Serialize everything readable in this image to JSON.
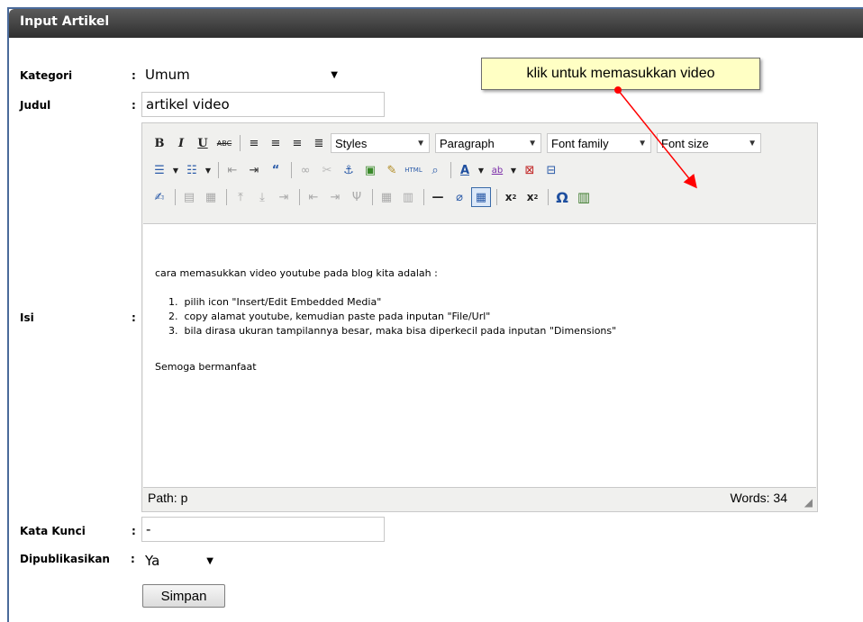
{
  "panel": {
    "title": "Input Artikel"
  },
  "form": {
    "kategori": {
      "label": "Kategori",
      "colon": ":",
      "value": "Umum"
    },
    "judul": {
      "label": "Judul",
      "colon": ":",
      "value": "artikel video"
    },
    "isi": {
      "label": "Isi",
      "colon": ":"
    },
    "kata_kunci": {
      "label": "Kata Kunci",
      "colon": ":",
      "value": "-"
    },
    "dipublikasikan": {
      "label": "Dipublikasikan",
      "colon": ":",
      "value": "Ya"
    },
    "submit_label": "Simpan"
  },
  "editor": {
    "dropdowns": {
      "styles": "Styles",
      "paragraph": "Paragraph",
      "font_family": "Font family",
      "font_size": "Font size"
    },
    "content": {
      "intro": "cara memasukkan video youtube pada blog kita adalah :",
      "steps": [
        "pilih icon \"Insert/Edit Embedded Media\"",
        "copy alamat youtube, kemudian paste pada inputan \"File/Url\"",
        "bila dirasa ukuran tampilannya besar, maka bisa diperkecil pada inputan \"Dimensions\""
      ],
      "closing": "Semoga bermanfaat"
    },
    "status": {
      "path": "Path: p",
      "words": "Words: 34"
    }
  },
  "annotation": {
    "text": "klik untuk memasukkan video",
    "color": "#ff0000"
  },
  "colors": {
    "header_bg": "#3a3a3a",
    "frame_border": "#4a6a9a",
    "callout_bg": "#ffffc4",
    "link_blue": "#1f5fbf"
  }
}
